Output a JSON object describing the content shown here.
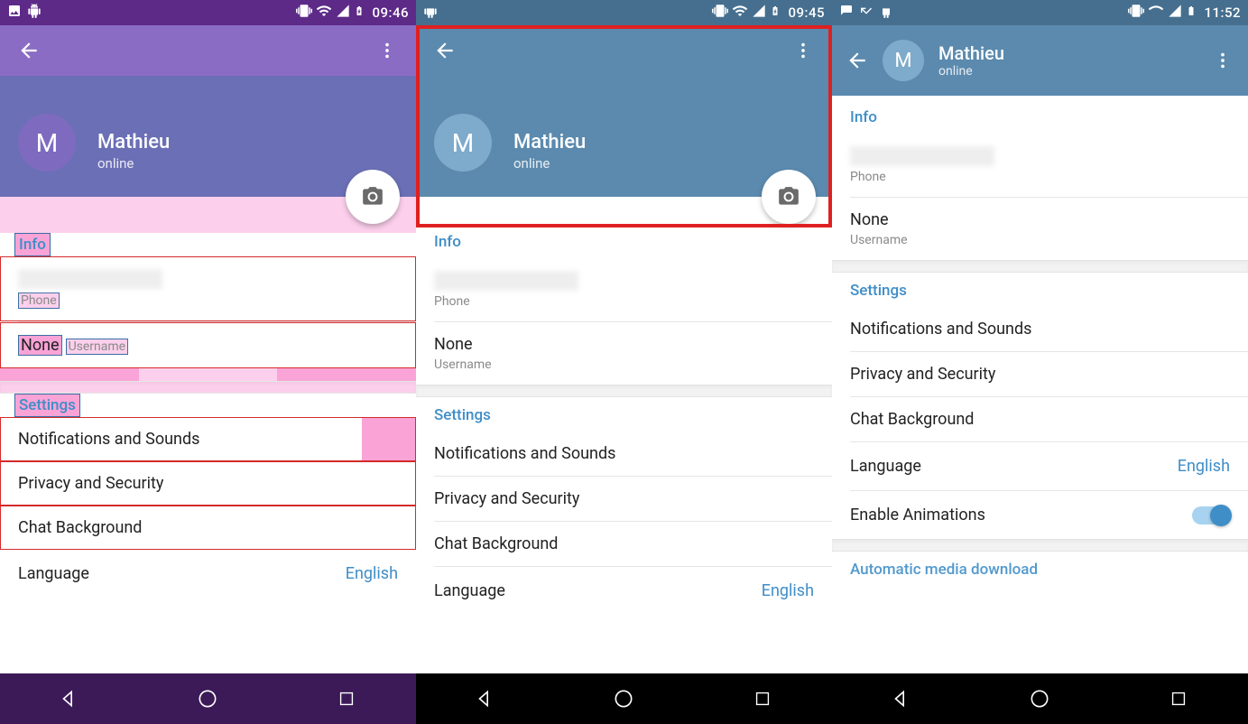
{
  "phones": [
    {
      "time": "09:46",
      "user": {
        "initial": "M",
        "name": "Mathieu",
        "status": "online"
      },
      "info_header": "Info",
      "phone_label": "Phone",
      "username_value": "None",
      "username_label": "Username",
      "settings_header": "Settings",
      "settings_items": [
        "Notifications and Sounds",
        "Privacy and Security",
        "Chat Background"
      ],
      "language_label": "Language",
      "language_value": "English"
    },
    {
      "time": "09:45",
      "user": {
        "initial": "M",
        "name": "Mathieu",
        "status": "online"
      },
      "info_header": "Info",
      "phone_label": "Phone",
      "username_value": "None",
      "username_label": "Username",
      "settings_header": "Settings",
      "settings_items": [
        "Notifications and Sounds",
        "Privacy and Security",
        "Chat Background"
      ],
      "language_label": "Language",
      "language_value": "English"
    },
    {
      "time": "11:52",
      "user": {
        "initial": "M",
        "name": "Mathieu",
        "status": "online"
      },
      "info_header": "Info",
      "phone_label": "Phone",
      "username_value": "None",
      "username_label": "Username",
      "settings_header": "Settings",
      "settings_items": [
        "Notifications and Sounds",
        "Privacy and Security",
        "Chat Background"
      ],
      "language_label": "Language",
      "language_value": "English",
      "animations_label": "Enable Animations",
      "auto_dl_label": "Automatic media download"
    }
  ]
}
